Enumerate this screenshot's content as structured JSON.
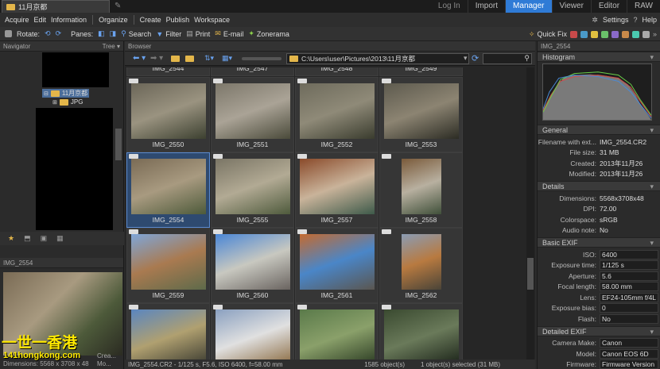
{
  "titlebar": {
    "tab": "11月京都",
    "modes": [
      "Log In",
      "Import",
      "Manager",
      "Viewer",
      "Editor",
      "RAW"
    ],
    "active_mode": "Manager"
  },
  "menu": [
    "Acquire",
    "Edit",
    "Information",
    "Organize",
    "Create",
    "Publish",
    "Workspace"
  ],
  "menu_right": {
    "settings": "Settings",
    "help": "Help"
  },
  "toolbar": {
    "rotate": "Rotate:",
    "panes": "Panes:",
    "search": "Search",
    "filter": "Filter",
    "print": "Print",
    "email": "E-mail",
    "zonerama": "Zonerama",
    "quickfix": "Quick Fix"
  },
  "navigator": {
    "title": "Navigator",
    "tree_label": "Tree",
    "folder_selected": "11月京都",
    "folder_child": "JPG"
  },
  "preview": {
    "title": "IMG_2554",
    "meta_line1": "Crea...",
    "meta_line2": "Dimensions: 5568 x 3708 x 48",
    "meta_line3": "Mo..."
  },
  "watermark": {
    "line1": "一世一香港",
    "line2": "141hongkong.com"
  },
  "browser": {
    "title": "Browser",
    "path": "C:\\Users\\user\\Pictures\\2013\\11月京都",
    "top_row": [
      "IMG_2544",
      "IMG_2547",
      "IMG_2548",
      "IMG_2549"
    ],
    "thumbs": [
      {
        "name": "IMG_2550",
        "c1": "#6b6658",
        "c2": "#9a9380",
        "c3": "#3c4030"
      },
      {
        "name": "IMG_2551",
        "c1": "#7c776a",
        "c2": "#aaa396",
        "c3": "#4a4a3a"
      },
      {
        "name": "IMG_2552",
        "c1": "#6e6b5c",
        "c2": "#8f8a78",
        "c3": "#3a3c2e"
      },
      {
        "name": "IMG_2553",
        "c1": "#5d5a4e",
        "c2": "#8c8472",
        "c3": "#2c2c24"
      },
      {
        "name": "IMG_2554",
        "c1": "#7a6b55",
        "c2": "#a89a80",
        "c3": "#4d5a3a",
        "selected": true
      },
      {
        "name": "IMG_2555",
        "c1": "#7a7565",
        "c2": "#b2aa94",
        "c3": "#4e5a3c"
      },
      {
        "name": "IMG_2557",
        "c1": "#8a4a2a",
        "c2": "#c9b39a",
        "c3": "#3e5a4a"
      },
      {
        "name": "IMG_2558",
        "c1": "#7a5a3a",
        "c2": "#b8b0a0",
        "c3": "#40503a",
        "narrow": true
      },
      {
        "name": "IMG_2559",
        "c1": "#7fa6d8",
        "c2": "#a97a50",
        "c3": "#5e6a4a"
      },
      {
        "name": "IMG_2560",
        "c1": "#4a86d6",
        "c2": "#c8c8c0",
        "c3": "#6a6460"
      },
      {
        "name": "IMG_2561",
        "c1": "#c46a30",
        "c2": "#4a86c8",
        "c3": "#5a5650"
      },
      {
        "name": "IMG_2562",
        "c1": "#8a9cb4",
        "c2": "#b87a40",
        "c3": "#4a4438",
        "narrow": true
      },
      {
        "name": "",
        "c1": "#5a86c0",
        "c2": "#b0a070",
        "c3": "#3a3a30"
      },
      {
        "name": "",
        "c1": "#8aa0c0",
        "c2": "#e0e0e0",
        "c3": "#8a6a40"
      },
      {
        "name": "",
        "c1": "#5a7a4a",
        "c2": "#8aa06a",
        "c3": "#2a3a22"
      },
      {
        "name": "",
        "c1": "#3a4a30",
        "c2": "#6a7a5a",
        "c3": "#1a2218"
      }
    ],
    "status_file": "IMG_2554.CR2 - 1/125 s, F5.6, ISO 6400, f=58.00 mm",
    "status_count": "1585 object(s)",
    "status_selected": "1 object(s) selected (31 MB)"
  },
  "right_panel": {
    "title": "IMG_2554",
    "histogram": "Histogram",
    "sections": [
      {
        "name": "General",
        "rows": [
          [
            "Filename with ext...",
            "IMG_2554.CR2",
            false
          ],
          [
            "File size:",
            "31 MB",
            false
          ],
          [
            "Created:",
            "2013年11月26",
            false
          ],
          [
            "Modified:",
            "2013年11月26",
            false
          ]
        ]
      },
      {
        "name": "Details",
        "rows": [
          [
            "Dimensions:",
            "5568x3708x48",
            false
          ],
          [
            "DPI:",
            "72.00",
            false
          ],
          [
            "Colorspace:",
            "sRGB",
            false
          ],
          [
            "Audio note:",
            "No",
            false
          ]
        ]
      },
      {
        "name": "Basic EXIF",
        "rows": [
          [
            "ISO:",
            "6400",
            true
          ],
          [
            "Exposure time:",
            "1/125 s",
            true
          ],
          [
            "Aperture:",
            "5.6",
            true
          ],
          [
            "Focal length:",
            "58.00 mm",
            true
          ],
          [
            "Lens:",
            "EF24-105mm f/4L",
            true
          ],
          [
            "Exposure bias:",
            "0",
            true
          ],
          [
            "Flash:",
            "No",
            true
          ]
        ]
      },
      {
        "name": "Detailed EXIF",
        "rows": [
          [
            "Camera Make:",
            "Canon",
            true
          ],
          [
            "Model:",
            "Canon EOS 6D",
            true
          ],
          [
            "Firmware:",
            "Firmware Version",
            true
          ]
        ]
      }
    ]
  }
}
